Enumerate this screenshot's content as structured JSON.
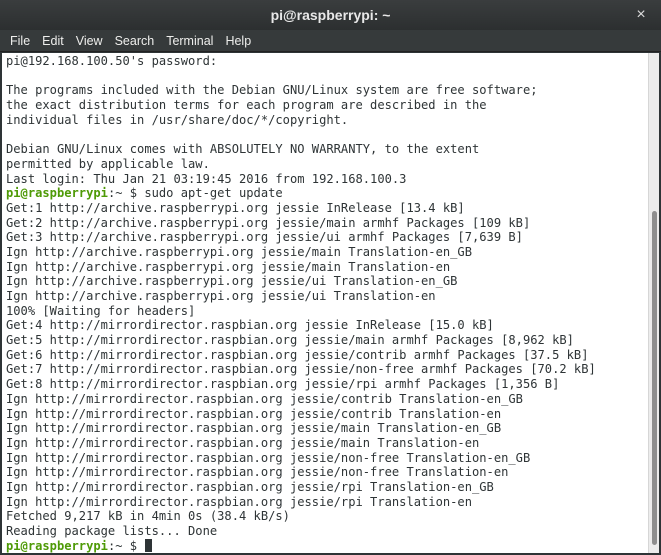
{
  "window": {
    "title": "pi@raspberrypi: ~",
    "close_glyph": "×"
  },
  "menu": [
    "File",
    "Edit",
    "View",
    "Search",
    "Terminal",
    "Help"
  ],
  "terminal": {
    "lines": [
      {
        "text": "pi@192.168.100.50's password:"
      },
      {
        "text": ""
      },
      {
        "text": "The programs included with the Debian GNU/Linux system are free software;"
      },
      {
        "text": "the exact distribution terms for each program are described in the"
      },
      {
        "text": "individual files in /usr/share/doc/*/copyright."
      },
      {
        "text": ""
      },
      {
        "text": "Debian GNU/Linux comes with ABSOLUTELY NO WARRANTY, to the extent"
      },
      {
        "text": "permitted by applicable law."
      },
      {
        "text": "Last login: Thu Jan 21 03:19:45 2016 from 192.168.100.3"
      },
      {
        "prompt_user": "pi@raspberrypi",
        "prompt_rest": ":~ $ ",
        "command": "sudo apt-get update"
      },
      {
        "text": "Get:1 http://archive.raspberrypi.org jessie InRelease [13.4 kB]"
      },
      {
        "text": "Get:2 http://archive.raspberrypi.org jessie/main armhf Packages [109 kB]"
      },
      {
        "text": "Get:3 http://archive.raspberrypi.org jessie/ui armhf Packages [7,639 B]"
      },
      {
        "text": "Ign http://archive.raspberrypi.org jessie/main Translation-en_GB"
      },
      {
        "text": "Ign http://archive.raspberrypi.org jessie/main Translation-en"
      },
      {
        "text": "Ign http://archive.raspberrypi.org jessie/ui Translation-en_GB"
      },
      {
        "text": "Ign http://archive.raspberrypi.org jessie/ui Translation-en"
      },
      {
        "text": "100% [Waiting for headers]"
      },
      {
        "text": "Get:4 http://mirrordirector.raspbian.org jessie InRelease [15.0 kB]"
      },
      {
        "text": "Get:5 http://mirrordirector.raspbian.org jessie/main armhf Packages [8,962 kB]"
      },
      {
        "text": "Get:6 http://mirrordirector.raspbian.org jessie/contrib armhf Packages [37.5 kB]"
      },
      {
        "text": "Get:7 http://mirrordirector.raspbian.org jessie/non-free armhf Packages [70.2 kB]"
      },
      {
        "text": "Get:8 http://mirrordirector.raspbian.org jessie/rpi armhf Packages [1,356 B]"
      },
      {
        "text": "Ign http://mirrordirector.raspbian.org jessie/contrib Translation-en_GB"
      },
      {
        "text": "Ign http://mirrordirector.raspbian.org jessie/contrib Translation-en"
      },
      {
        "text": "Ign http://mirrordirector.raspbian.org jessie/main Translation-en_GB"
      },
      {
        "text": "Ign http://mirrordirector.raspbian.org jessie/main Translation-en"
      },
      {
        "text": "Ign http://mirrordirector.raspbian.org jessie/non-free Translation-en_GB"
      },
      {
        "text": "Ign http://mirrordirector.raspbian.org jessie/non-free Translation-en"
      },
      {
        "text": "Ign http://mirrordirector.raspbian.org jessie/rpi Translation-en_GB"
      },
      {
        "text": "Ign http://mirrordirector.raspbian.org jessie/rpi Translation-en"
      },
      {
        "text": "Fetched 9,217 kB in 4min 0s (38.4 kB/s)"
      },
      {
        "text": "Reading package lists... Done"
      },
      {
        "prompt_user": "pi@raspberrypi",
        "prompt_rest": ":~ $ ",
        "command": "",
        "cursor": true
      }
    ]
  },
  "colors": {
    "terminal_bg": "#ffffff",
    "terminal_fg": "#2e3436",
    "prompt_user": "#4e9a06",
    "titlebar_bg": "#2c2f30"
  }
}
